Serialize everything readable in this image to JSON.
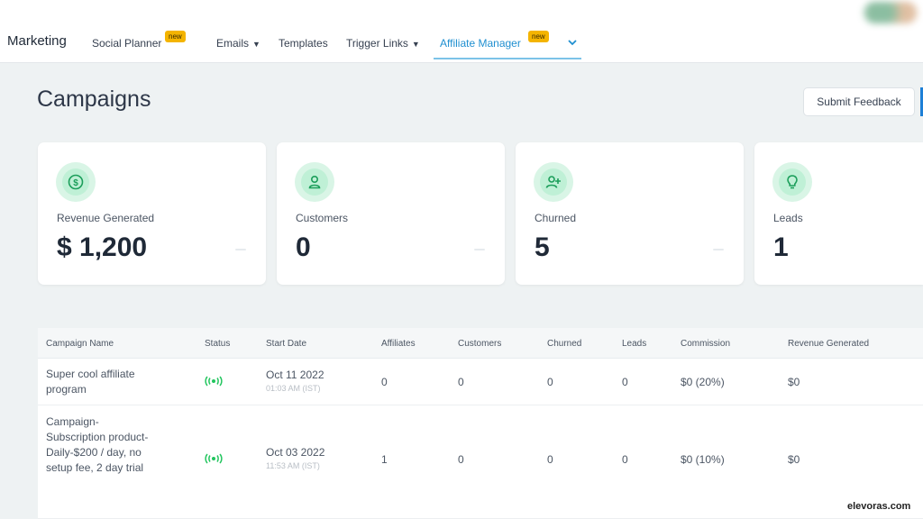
{
  "nav": {
    "brand": "Marketing",
    "items": [
      {
        "label": "Social Planner",
        "badge": "new"
      },
      {
        "label": "Emails"
      },
      {
        "label": "Templates"
      },
      {
        "label": "Trigger Links"
      },
      {
        "label": "Affiliate Manager",
        "badge": "new"
      }
    ]
  },
  "page": {
    "title": "Campaigns",
    "feedback_label": "Submit Feedback"
  },
  "stats": [
    {
      "label": "Revenue Generated",
      "value": "$ 1,200",
      "icon": "dollar-icon"
    },
    {
      "label": "Customers",
      "value": "0",
      "icon": "user-icon"
    },
    {
      "label": "Churned",
      "value": "5",
      "icon": "user-plus-icon"
    },
    {
      "label": "Leads",
      "value": "1",
      "icon": "lightbulb-icon"
    }
  ],
  "table": {
    "columns": [
      "Campaign Name",
      "Status",
      "Start Date",
      "Affiliates",
      "Customers",
      "Churned",
      "Leads",
      "Commission",
      "Revenue Generated"
    ],
    "rows": [
      {
        "name": "Super cool affiliate program",
        "status": "live-icon",
        "start_date": "Oct 11 2022",
        "start_time": "01:03 AM (IST)",
        "affiliates": "0",
        "customers": "0",
        "churned": "0",
        "leads": "0",
        "commission": "$0 (20%)",
        "revenue": "$0"
      },
      {
        "name": "Campaign-Subscription product-Daily-$200 / day, no setup fee, 2 day trial",
        "status": "live-icon",
        "start_date": "Oct 03 2022",
        "start_time": "11:53 AM (IST)",
        "affiliates": "1",
        "customers": "0",
        "churned": "0",
        "leads": "0",
        "commission": "$0 (10%)",
        "revenue": "$0"
      }
    ]
  },
  "colors": {
    "accent": "#1f8fd0",
    "badge": "#f4b400",
    "status_live": "#22c55e",
    "icon_bg": "#d9f5e6"
  },
  "watermark": "elevoras.com"
}
